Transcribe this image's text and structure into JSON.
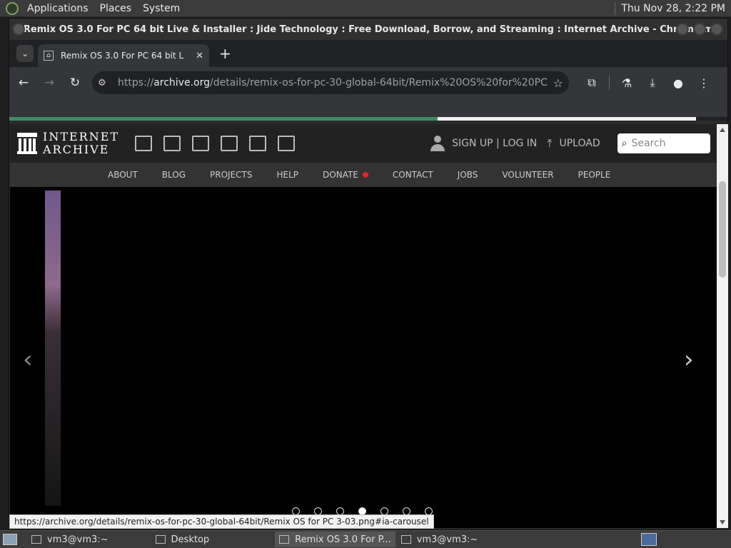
{
  "top_panel": {
    "menus": [
      "Applications",
      "Places",
      "System"
    ],
    "clock": "Thu Nov 28,  2:22 PM"
  },
  "window": {
    "title": "Remix OS 3.0 For PC 64 bit Live & Installer : Jide Technology : Free Download, Borrow, and Streaming : Internet Archive - Chromium"
  },
  "tabs": [
    {
      "title": "Remix OS 3.0 For PC 64 bit L",
      "close": "✕"
    }
  ],
  "toolbar": {
    "url_scheme": "https://",
    "url_host": "archive.org",
    "url_path": "/details/remix-os-for-pc-30-global-64bit/Remix%20OS%20for%20PC%2..."
  },
  "ia": {
    "logo_line1": "INTERNET",
    "logo_line2": "ARCHIVE",
    "signup": "SIGN UP | LOG IN",
    "upload": "UPLOAD",
    "search_placeholder": "Search",
    "nav": [
      "ABOUT",
      "BLOG",
      "PROJECTS",
      "HELP",
      "DONATE",
      "CONTACT",
      "JOBS",
      "VOLUNTEER",
      "PEOPLE"
    ]
  },
  "carousel": {
    "dot_count": 7,
    "active_dot": 3
  },
  "status_url": "https://archive.org/details/remix-os-for-pc-30-global-64bit/Remix OS for PC 3-03.png#ia-carousel",
  "taskbar": [
    {
      "label": "vm3@vm3:~",
      "active": false
    },
    {
      "label": "Desktop",
      "active": false
    },
    {
      "label": "Remix OS 3.0 For P...",
      "active": true
    },
    {
      "label": "vm3@vm3:~",
      "active": false
    }
  ]
}
